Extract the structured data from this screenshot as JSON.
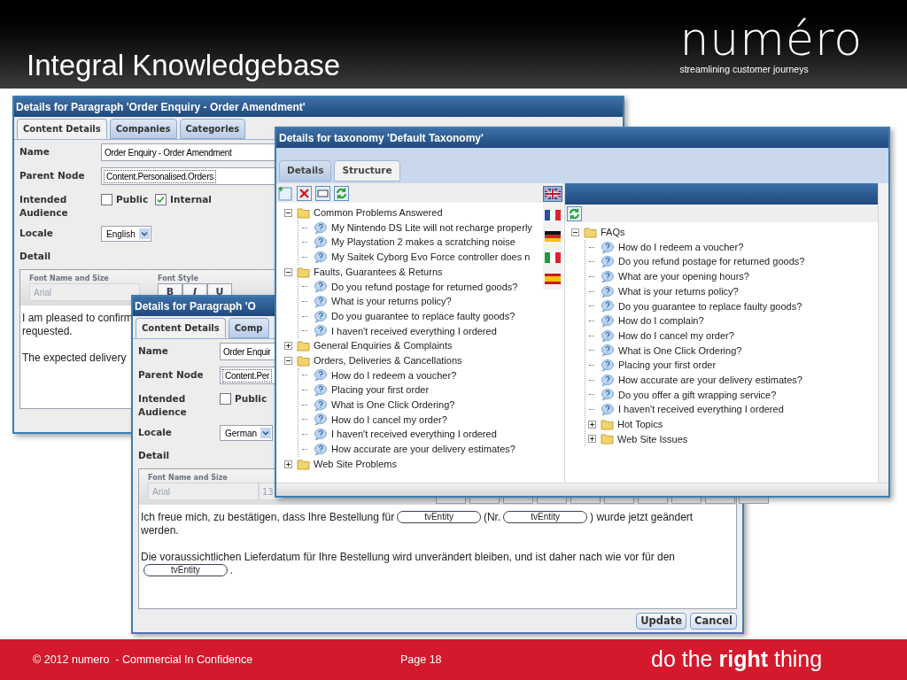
{
  "slide": {
    "title": "Integral Knowledgebase",
    "logo": "numéro",
    "tagline": "streamlining customer journeys"
  },
  "paragraph_windows": [
    {
      "title": "Details for Paragraph 'Order Enquiry - Order Amendment'",
      "tabs": [
        {
          "label": "Content Details",
          "selected": true
        },
        {
          "label": "Companies",
          "selected": false
        },
        {
          "label": "Categories",
          "selected": false
        }
      ],
      "name_label": "Name",
      "name": "Order Enquiry - Order Amendment",
      "parent_label": "Parent Node",
      "parent": "Content.Personalised.Orders",
      "audience_label": "Intended Audience",
      "audience": [
        {
          "label": "Public",
          "checked": false
        },
        {
          "label": "Internal",
          "checked": true
        }
      ],
      "locale_label": "Locale",
      "locale": "English",
      "detail_label": "Detail",
      "editor": {
        "font_label": "Font Name and Size",
        "font": "Arial",
        "style_label": "Font Style",
        "style_buttons": [
          "B",
          "I",
          "U"
        ]
      },
      "paragraphs": [
        [
          [
            {
              "kind": "text",
              "text": "I am pleased to confirm"
            }
          ],
          [
            {
              "kind": "text",
              "text": "requested."
            }
          ]
        ],
        [
          [
            {
              "kind": "text",
              "text": "The expected delivery"
            }
          ]
        ]
      ]
    },
    {
      "title": "Details for Paragraph 'O",
      "tabs": [
        {
          "label": "Content Details",
          "selected": true
        },
        {
          "label": "Comp",
          "selected": false
        }
      ],
      "name_label": "Name",
      "name": "Order Enquir",
      "parent_label": "Parent Node",
      "parent": "Content.Per",
      "audience_label": "Intended Audience",
      "audience": [
        {
          "label": "Public",
          "checked": false
        }
      ],
      "locale_label": "Locale",
      "locale": "German",
      "detail_label": "Detail",
      "editor": {
        "font_label": "Font Name and Size",
        "font": "Arial",
        "size": "13"
      },
      "paragraphs": [
        [
          [
            {
              "kind": "text",
              "text": "Ich freue mich, zu bestätigen, dass Ihre Bestellung für"
            },
            {
              "kind": "token",
              "text": "tvEntity"
            },
            {
              "kind": "text",
              "text": "(Nr."
            },
            {
              "kind": "token",
              "text": "tvEntity"
            },
            {
              "kind": "text",
              "text": ") wurde jetzt geändert"
            }
          ],
          [
            {
              "kind": "text",
              "text": "werden."
            }
          ]
        ],
        [
          [
            {
              "kind": "text",
              "text": "Die voraussichtlichen Lieferdatum für Ihre Bestellung wird unverändert bleiben, und ist daher nach wie vor für den"
            }
          ],
          [
            {
              "kind": "token",
              "text": "tvEntity"
            },
            {
              "kind": "text",
              "text": "."
            }
          ]
        ]
      ],
      "buttons": [
        "Update",
        "Cancel"
      ]
    }
  ],
  "taxonomy_window": {
    "title": "Details for taxonomy 'Default Taxonomy'",
    "tabs": [
      {
        "label": "Details",
        "selected": false
      },
      {
        "label": "Structure",
        "selected": true
      }
    ],
    "languages": [
      {
        "kind": "english",
        "selected": true
      },
      {
        "kind": "french",
        "selected": false
      },
      {
        "kind": "german",
        "selected": false
      },
      {
        "kind": "italian",
        "selected": false
      },
      {
        "kind": "spanish",
        "selected": false
      }
    ],
    "left_tree": [
      {
        "kind": "folder",
        "label": "Common Problems Answered",
        "expanded": true,
        "children": [
          {
            "kind": "question",
            "label": "My Nintendo DS Lite will not recharge properly"
          },
          {
            "kind": "question",
            "label": "My Playstation 2 makes a scratching noise"
          },
          {
            "kind": "question",
            "label": "My Saitek Cyborg Evo Force controller does n"
          }
        ]
      },
      {
        "kind": "folder",
        "label": "Faults, Guarantees & Returns",
        "expanded": true,
        "children": [
          {
            "kind": "question",
            "label": "Do you refund postage for returned goods?"
          },
          {
            "kind": "question",
            "label": "What is your returns policy?"
          },
          {
            "kind": "question",
            "label": "Do you guarantee to replace faulty goods?"
          },
          {
            "kind": "question",
            "label": "I haven't received everything I ordered"
          }
        ]
      },
      {
        "kind": "folder",
        "label": "General Enquiries & Complaints",
        "expanded": false
      },
      {
        "kind": "folder",
        "label": "Orders, Deliveries & Cancellations",
        "expanded": true,
        "children": [
          {
            "kind": "question",
            "label": "How do I redeem a voucher?"
          },
          {
            "kind": "question",
            "label": "Placing your first order"
          },
          {
            "kind": "question",
            "label": "What is One Click Ordering?"
          },
          {
            "kind": "question",
            "label": "How do I cancel my order?"
          },
          {
            "kind": "question",
            "label": "I haven't received everything I ordered"
          },
          {
            "kind": "question",
            "label": "How accurate are your delivery estimates?"
          }
        ]
      },
      {
        "kind": "folder",
        "label": "Web Site Problems",
        "expanded": false
      }
    ],
    "right_tree": [
      {
        "kind": "folder",
        "label": "FAQs",
        "expanded": true,
        "children": [
          {
            "kind": "question",
            "label": "How do I redeem a voucher?"
          },
          {
            "kind": "question",
            "label": "Do you refund postage for returned goods?"
          },
          {
            "kind": "question",
            "label": "What are your opening hours?"
          },
          {
            "kind": "question",
            "label": "What is your returns policy?"
          },
          {
            "kind": "question",
            "label": "Do you guarantee to replace faulty goods?"
          },
          {
            "kind": "question",
            "label": "How do I complain?"
          },
          {
            "kind": "question",
            "label": "How do I cancel my order?"
          },
          {
            "kind": "question",
            "label": "What is One Click Ordering?"
          },
          {
            "kind": "question",
            "label": "Placing your first order"
          },
          {
            "kind": "question",
            "label": "How accurate are your delivery estimates?"
          },
          {
            "kind": "question",
            "label": "Do you offer a gift wrapping service?"
          },
          {
            "kind": "question",
            "label": "I haven't received everything I ordered"
          },
          {
            "kind": "folder",
            "label": "Hot Topics",
            "expanded": false
          },
          {
            "kind": "folder",
            "label": "Web Site Issues",
            "expanded": false
          }
        ]
      }
    ]
  },
  "footer": {
    "copyright": "© 2012 numero  - Commercial In Confidence",
    "page": "Page 18",
    "slogan": "do the **right** thing"
  }
}
